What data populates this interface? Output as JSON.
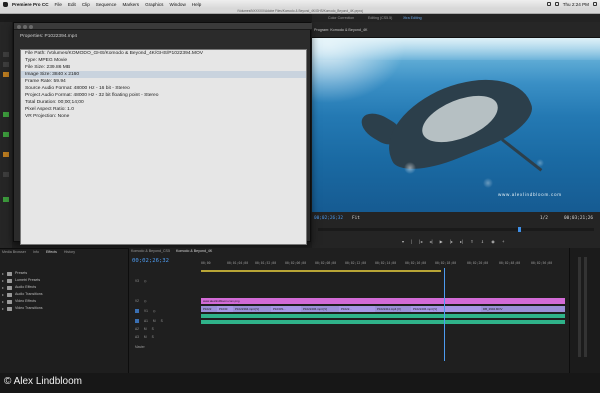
{
  "menubar": {
    "app": "Premiere Pro CC",
    "items": [
      "File",
      "Edit",
      "Clip",
      "Sequence",
      "Markers",
      "Graphics",
      "Window",
      "Help"
    ],
    "clock": "Thu 2:24 PM"
  },
  "window": {
    "title": "/Volumes/NXXXXX/Adobe Files/Komodo & Beyond_4K/GHS/Komodo_Beyond_4K.prproj"
  },
  "workspaces": {
    "items": [
      "Color Correction",
      "Editing (CS5.5)",
      "Xtra Editing"
    ],
    "selected": "Xtra Editing"
  },
  "program": {
    "label": "Program: Komodo & Beyond_4K",
    "current_tc": "00;02;26;32",
    "duration_tc": "00;03;21;26",
    "fit": "Fit",
    "quality": "1/2"
  },
  "watermark": "www.alexlindbloom.com",
  "dialog": {
    "title": "Properties: P1022394.mp4",
    "lines": [
      "File Path: /Volumes/KOMODO_GHS/Komodo & Beyond_4K/GHS/P1022394.MOV",
      "Type: MPEG Movie",
      "File Size: 239.86 MB",
      "Image Size: 3840 x 2160",
      "Frame Rate: 59.94",
      "Source Audio Format: 48000 Hz - 16 bit - Stereo",
      "Project Audio Format: 48000 Hz - 32 bit floating point - Stereo",
      "Total Duration: 00;00;14;00",
      "Pixel Aspect Ratio: 1.0",
      "VR Projection: None"
    ],
    "highlight_index": 3
  },
  "effects": {
    "tabs": [
      "Media Browser",
      "Info",
      "Effects",
      "History"
    ],
    "active_tab": "Effects",
    "folders": [
      "Presets",
      "Lumetri Presets",
      "Audio Effects",
      "Audio Transitions",
      "Video Effects",
      "Video Transitions"
    ]
  },
  "timeline": {
    "tabs": [
      "Komodo & Beyond_CS5",
      "Komodo & Beyond_4K"
    ],
    "active_tab": "Komodo & Beyond_4K",
    "timecode": "00;02;26;32",
    "ruler": [
      "00;00",
      "00;01;04;00",
      "00;01;52;00",
      "00;02;06;00",
      "00;02;08;00",
      "00;02;12;00",
      "00;02;14;00",
      "00;02;16;00",
      "00;02;18;00",
      "00;02;20;00",
      "00;02;48;00",
      "00;02;56;00"
    ],
    "tracks": [
      "V3",
      "V2",
      "V1",
      "A1",
      "A2",
      "A3"
    ],
    "gfx_clip": "www.alexlindbloom.com.png",
    "v_clips": [
      "P1022",
      "P1030",
      "P1022394.mp4 [V]",
      "P1030S...",
      "P1022406.mp4 [V]",
      "P1022...",
      "P1022411.mp4 [V]",
      "P1022406.mp4 [V]",
      "DB_2904.MOV"
    ],
    "master": "Master"
  },
  "footer": {
    "credit": "© Alex Lindbloom"
  }
}
